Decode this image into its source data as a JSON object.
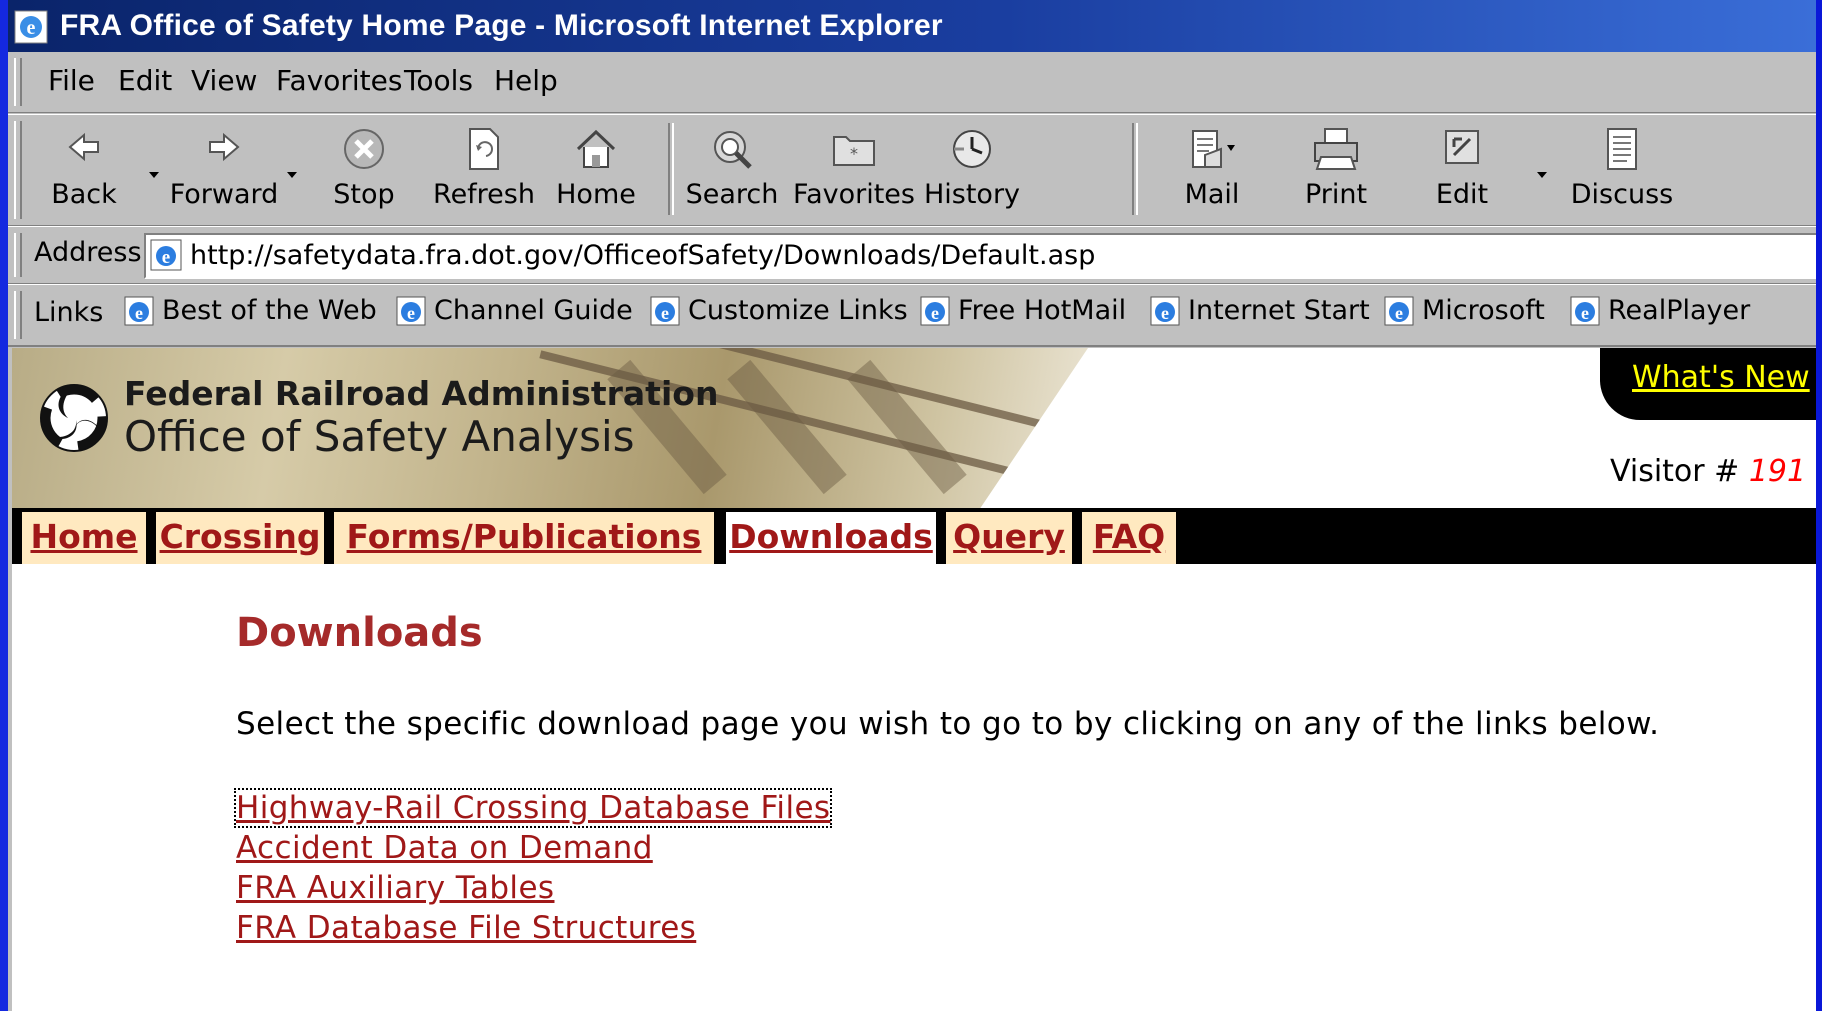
{
  "window": {
    "title": "FRA Office of Safety Home Page - Microsoft Internet Explorer"
  },
  "menu": [
    "File",
    "Edit",
    "View",
    "Favorites",
    "Tools",
    "Help"
  ],
  "toolbar": {
    "back": "Back",
    "forward": "Forward",
    "stop": "Stop",
    "refresh": "Refresh",
    "home": "Home",
    "search": "Search",
    "favorites": "Favorites",
    "history": "History",
    "mail": "Mail",
    "print": "Print",
    "edit": "Edit",
    "discuss": "Discuss"
  },
  "address": {
    "label": "Address",
    "url": "http://safetydata.fra.dot.gov/OfficeofSafety/Downloads/Default.asp"
  },
  "links": {
    "label": "Links",
    "items": [
      "Best of the Web",
      "Channel Guide",
      "Customize Links",
      "Free HotMail",
      "Internet Start",
      "Microsoft",
      "RealPlayer"
    ]
  },
  "page": {
    "banner_line1": "Federal Railroad Administration",
    "banner_line2": "Office of Safety Analysis",
    "whats_new": "What's New",
    "visitor_label": "Visitor #",
    "visitor_number": "191",
    "nav": [
      "Home",
      "Crossing",
      "Forms/Publications",
      "Downloads",
      "Query",
      "FAQ"
    ],
    "active_nav": "Downloads",
    "title": "Downloads",
    "intro": "Select the specific download page you wish to go to by clicking on any of the links below.",
    "download_links": [
      "Highway-Rail Crossing Database Files",
      "Accident Data on Demand",
      "FRA Auxiliary Tables",
      "FRA Database File Structures"
    ]
  },
  "colors": {
    "titlebar": "#0a246a",
    "nav_tab": "#ffe9c0",
    "link": "#a01818",
    "heading": "#a52a2a",
    "whats_new": "#ffff00",
    "visitor_number": "#ff0000"
  }
}
